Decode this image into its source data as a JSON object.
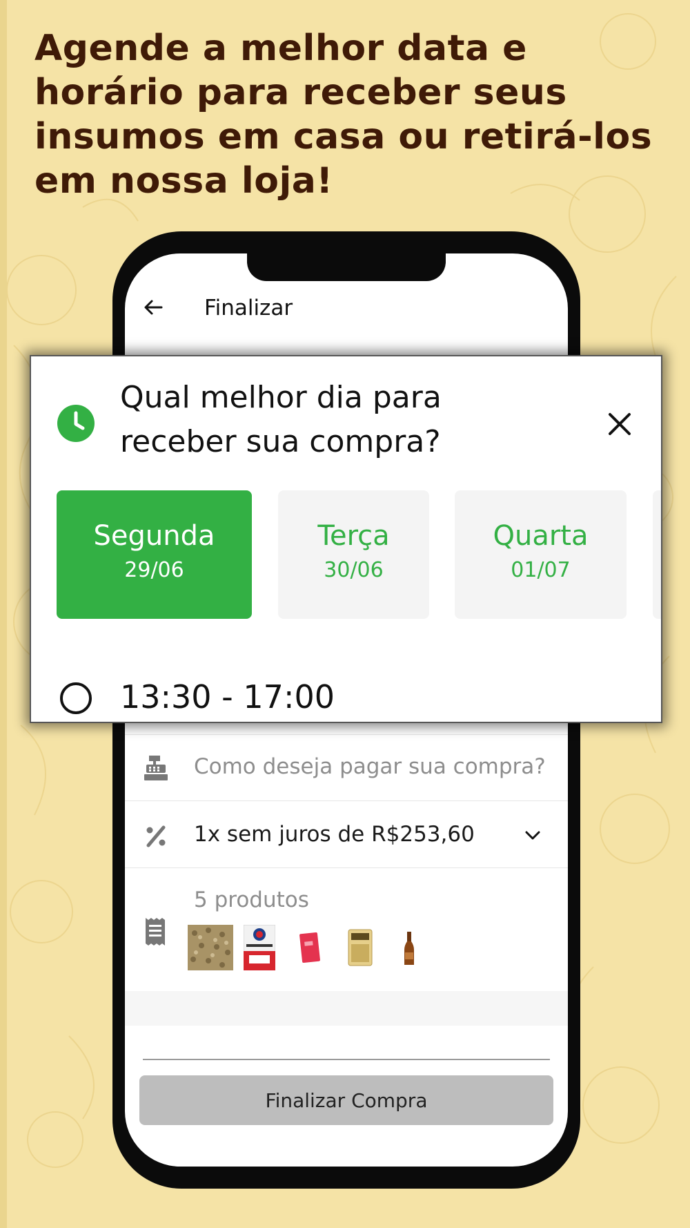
{
  "headline": "Agende a melhor data e horário para receber seus insumos em casa ou retirá-los em nossa loja!",
  "header": {
    "title": "Finalizar",
    "back_icon": "arrow-left-icon"
  },
  "delivery_modal": {
    "title": "Qual melhor dia para receber sua compra?",
    "icon": "clock-icon",
    "close_icon": "close-icon",
    "days": [
      {
        "name": "Segunda",
        "date": "29/06",
        "selected": true
      },
      {
        "name": "Terça",
        "date": "30/06",
        "selected": false
      },
      {
        "name": "Quarta",
        "date": "01/07",
        "selected": false
      }
    ],
    "time_slot": "13:30 - 17:00"
  },
  "payment": {
    "placeholder": "Como deseja pagar sua compra?",
    "icon": "cash-register-icon"
  },
  "installments": {
    "label": "1x sem juros de R$253,60",
    "icon": "percent-icon"
  },
  "products": {
    "label": "5 produtos",
    "icon": "receipt-icon"
  },
  "finish_button": "Finalizar Compra",
  "colors": {
    "accent": "#33b044",
    "background": "#f5e3a6",
    "headline": "#3f1a07",
    "button": "#bdbdbd"
  }
}
